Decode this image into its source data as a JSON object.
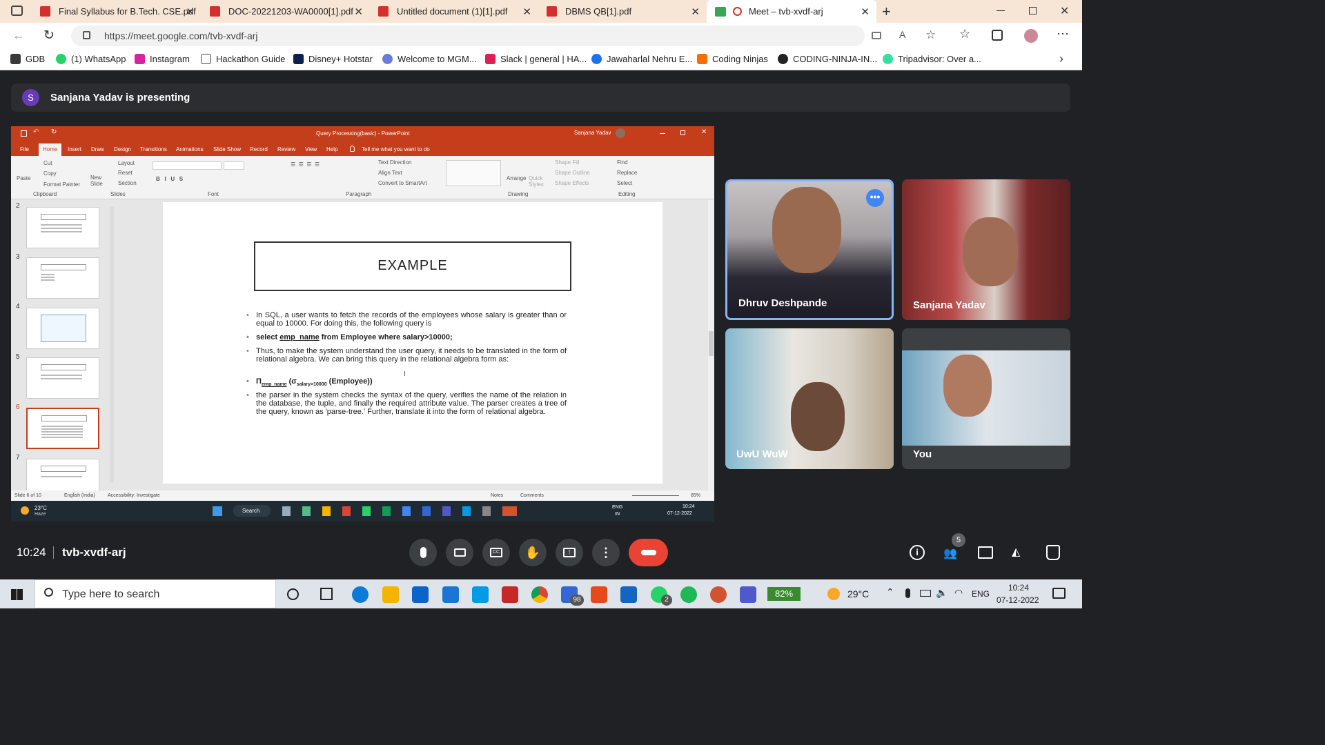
{
  "browser": {
    "tabs": [
      {
        "label": "Final Syllabus for B.Tech. CSE.pdf"
      },
      {
        "label": "DOC-20221203-WA0000[1].pdf"
      },
      {
        "label": "Untitled document (1)[1].pdf"
      },
      {
        "label": "DBMS QB[1].pdf"
      },
      {
        "label": "Meet – tvb-xvdf-arj"
      }
    ],
    "url": "https://meet.google.com/tvb-xvdf-arj",
    "bookmarks": [
      "GDB",
      "(1) WhatsApp",
      "Instagram",
      "Hackathon Guide",
      "Disney+ Hotstar",
      "Welcome to MGM...",
      "Slack | general | HA...",
      "Jawaharlal Nehru E...",
      "Coding Ninjas",
      "CODING-NINJA-IN...",
      "Tripadvisor: Over a..."
    ]
  },
  "meet": {
    "presenter_initial": "S",
    "presenter_text": "Sanjana Yadav is presenting",
    "time": "10:24",
    "meeting_code": "tvb-xvdf-arj",
    "people_count": "5",
    "participants": [
      "Dhruv Deshpande",
      "Sanjana Yadav",
      "UwU WuW",
      "You"
    ]
  },
  "ppt": {
    "title": "Query Processing(basic) - PowerPoint",
    "user": "Sanjana Yadav",
    "menu": [
      "File",
      "Home",
      "Insert",
      "Draw",
      "Design",
      "Transitions",
      "Animations",
      "Slide Show",
      "Record",
      "Review",
      "View",
      "Help",
      "Tell me what you want to do"
    ],
    "groups": [
      "Clipboard",
      "Slides",
      "Font",
      "Paragraph",
      "Drawing",
      "Editing"
    ],
    "ribbon": {
      "paste": "Paste",
      "cut": "Cut",
      "copy": "Copy",
      "format_painter": "Format Painter",
      "new_slide": "New Slide",
      "layout": "Layout",
      "reset": "Reset",
      "section": "Section",
      "text_direction": "Text Direction",
      "align_text": "Align Text",
      "convert": "Convert to SmartArt",
      "arrange": "Arrange",
      "quick_styles": "Quick Styles",
      "shape_fill": "Shape Fill",
      "shape_outline": "Shape Outline",
      "shape_effects": "Shape Effects",
      "find": "Find",
      "replace": "Replace",
      "select": "Select"
    },
    "thumb_numbers": [
      "2",
      "3",
      "4",
      "5",
      "6",
      "7"
    ],
    "thumb_titles": [
      "QUERY PROCESSING",
      "QUERY PROCESSING STEPS",
      "",
      "PARSING AND TRANSLATION",
      "EXAMPLE",
      "EVALUATION"
    ],
    "slide": {
      "heading": "EXAMPLE",
      "b1": "In SQL, a user wants to fetch the records of the employees whose salary is greater than or equal to 10000. For doing this, the following query is",
      "b2_pre": "select ",
      "b2_col": "emp_name",
      "b2_post": " from Employee where salary>10000;",
      "b3": "Thus, to make the system understand the user query, it needs to be translated in the form of relational algebra. We can bring this query in the relational algebra form as:",
      "b4_pi": "Π",
      "b4_sub": "emp_name",
      "b4_sigma": "(σ",
      "b4_sub2": "salary>10000",
      "b4_post": " (Employee))",
      "b5": "the parser in the system checks the syntax of the query, verifies the name of the relation in the database, the tuple, and finally the required attribute value. The parser creates a tree of the query, known as 'parse-tree.' Further, translate it into the form of relational algebra."
    },
    "status": {
      "slide": "Slide 6 of 10",
      "lang": "English (India)",
      "access": "Accessibility: Investigate",
      "notes": "Notes",
      "comments": "Comments",
      "zoom": "85%"
    },
    "inner_taskbar": {
      "temp": "23°C",
      "weather": "Haze",
      "search": "Search",
      "lang1": "ENG",
      "lang2": "IN",
      "time": "10:24",
      "date": "07-12-2022"
    }
  },
  "taskbar": {
    "search_placeholder": "Type here to search",
    "battery": "82%",
    "temp": "29°C",
    "lang": "ENG",
    "time": "10:24",
    "date": "07-12-2022",
    "badge_98": "98",
    "badge_2": "2"
  },
  "colors": {
    "ppt_accent": "#c43e1c",
    "end_call": "#ea4335",
    "active_tile": "#8ab4f8",
    "presenter_avatar": "#673ab7"
  }
}
